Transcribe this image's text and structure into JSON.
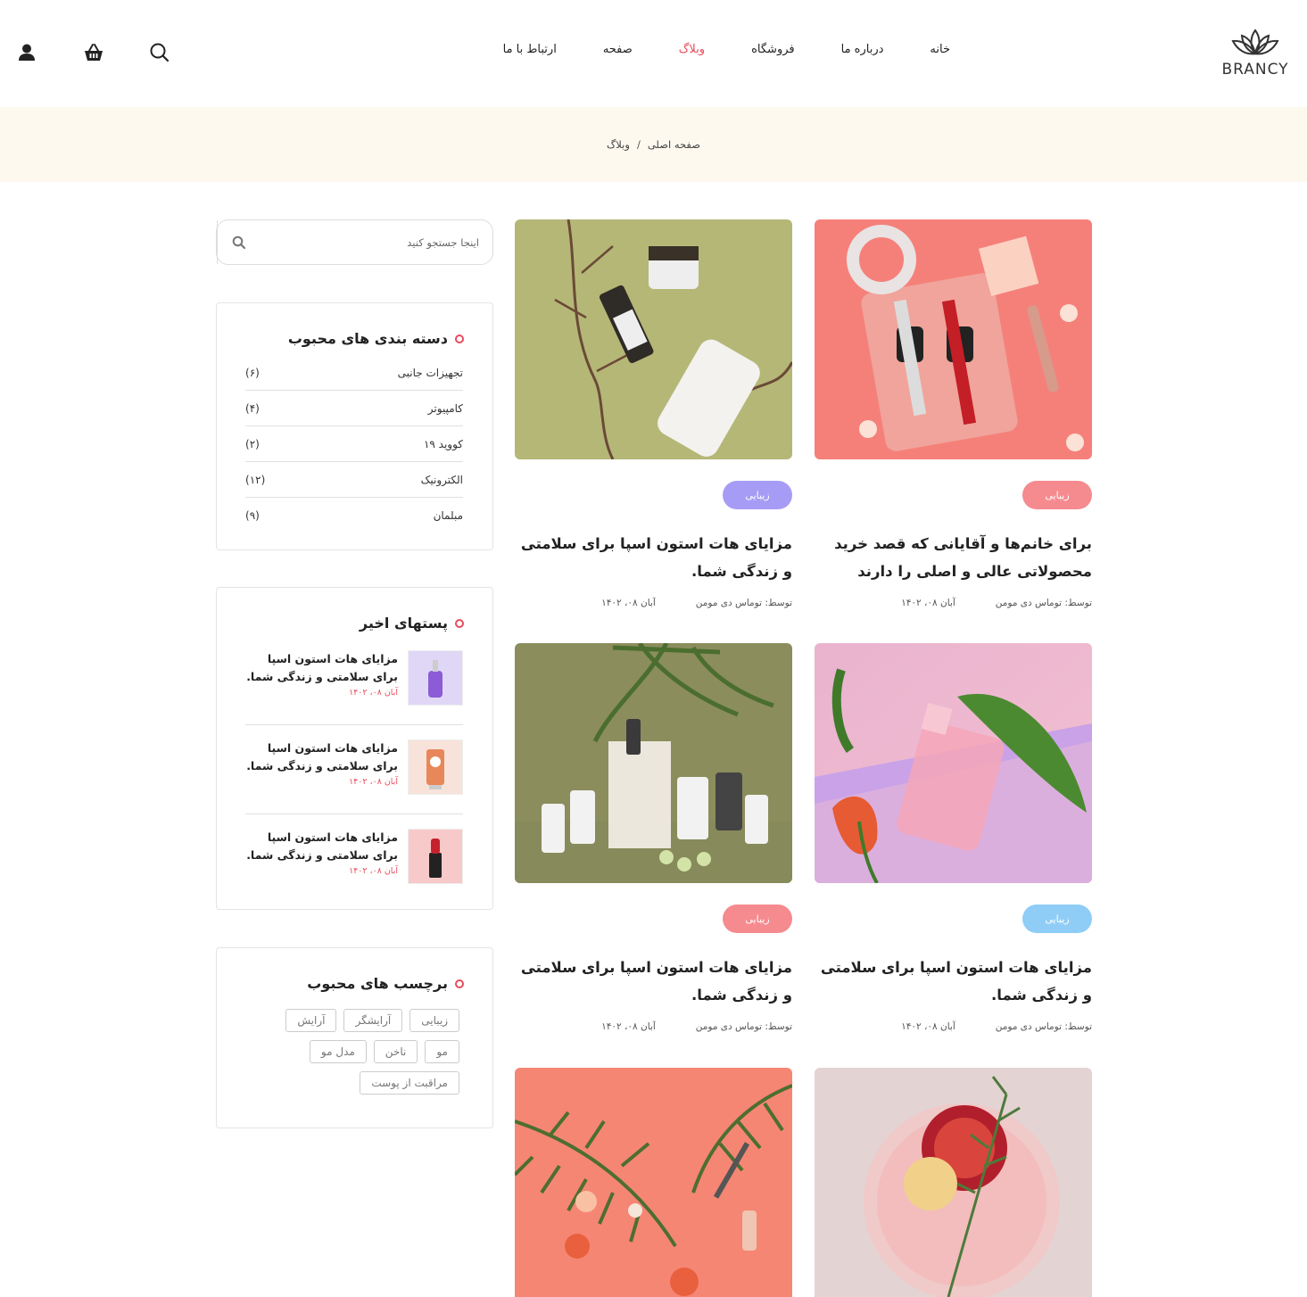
{
  "brand": {
    "name": "BRANCY",
    "accent": "#e84b5b"
  },
  "nav": [
    {
      "label": "خانه",
      "active": false
    },
    {
      "label": "درباره ما",
      "active": false
    },
    {
      "label": "فروشگاه",
      "active": false
    },
    {
      "label": "وبلاگ",
      "active": true
    },
    {
      "label": "صفحه",
      "active": false
    },
    {
      "label": "ارتباط با ما",
      "active": false
    }
  ],
  "header_icons": [
    "search-icon",
    "basket-icon",
    "user-icon"
  ],
  "breadcrumb": {
    "home": "صفحه اصلی",
    "separator": "/",
    "current": "وبلاگ"
  },
  "search": {
    "placeholder": "اینجا جستجو کنید"
  },
  "categories": {
    "title": "دسته بندی های محبوب",
    "items": [
      {
        "label": "تجهیزات جانبی",
        "count": "(۶)"
      },
      {
        "label": "کامپیوتر",
        "count": "(۴)"
      },
      {
        "label": "کووید ۱۹",
        "count": "(۲)"
      },
      {
        "label": "الکترونیک",
        "count": "(۱۲)"
      },
      {
        "label": "مبلمان",
        "count": "(۹)"
      }
    ]
  },
  "recent_posts": {
    "title": "پستهای اخیر",
    "items": [
      {
        "title": "مزایای هات استون اسپا برای سلامتی و زندگی شما.",
        "date": "آبان ۰۸، ۱۴۰۲"
      },
      {
        "title": "مزایای هات استون اسپا برای سلامتی و زندگی شما.",
        "date": "آبان ۰۸، ۱۴۰۲"
      },
      {
        "title": "مزایای هات استون اسپا برای سلامتی و زندگی شما.",
        "date": "آبان ۰۸، ۱۴۰۲"
      }
    ]
  },
  "tags": {
    "title": "برچسب های محبوب",
    "items": [
      "زیبایی",
      "آرایشگر",
      "آرایش",
      "مو",
      "ناخن",
      "مدل مو",
      "مراقبت از پوست"
    ]
  },
  "posts": [
    {
      "badge": "زیبایی",
      "badge_color": "#f58a8f",
      "title": "برای خانم‌ها و آقایانی که قصد خرید محصولاتی عالی و اصلی را دارند",
      "author": "توسط: توماس دی مومن",
      "date": "آبان ۰۸، ۱۴۰۲"
    },
    {
      "badge": "زیبایی",
      "badge_color": "#a79cf5",
      "title": "مزایای هات استون اسپا برای سلامتی و زندگی شما.",
      "author": "توسط: توماس دی مومن",
      "date": "آبان ۰۸، ۱۴۰۲"
    },
    {
      "badge": "زیبایی",
      "badge_color": "#8fcdf7",
      "title": "مزایای هات استون اسپا برای سلامتی و زندگی شما.",
      "author": "توسط: توماس دی مومن",
      "date": "آبان ۰۸، ۱۴۰۲"
    },
    {
      "badge": "زیبایی",
      "badge_color": "#f58a8f",
      "title": "مزایای هات استون اسپا برای سلامتی و زندگی شما.",
      "author": "توسط: توماس دی مومن",
      "date": "آبان ۰۸، ۱۴۰۲"
    },
    {
      "badge": "",
      "badge_color": "",
      "title": "",
      "author": "",
      "date": ""
    },
    {
      "badge": "",
      "badge_color": "",
      "title": "",
      "author": "",
      "date": ""
    }
  ]
}
